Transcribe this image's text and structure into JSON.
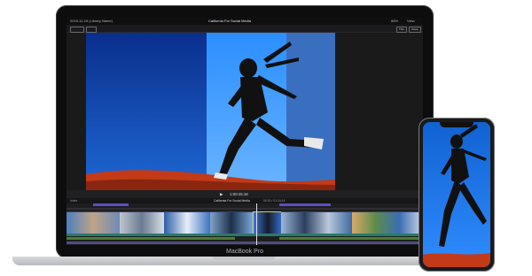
{
  "menubar": {
    "library_name": "2019-11-15 (Library Name)",
    "project_title": "California For Social Media",
    "zoom": "86%",
    "view_label": "View"
  },
  "toolbar": {
    "button_labels": [
      "Trim",
      "Done"
    ]
  },
  "transport": {
    "timecode": "1:00:45:18"
  },
  "timeline_header": {
    "label": "Index",
    "title": "California For Social Media",
    "duration": "00:30 / 01:24:14"
  },
  "device_label": "MacBook Pro",
  "colors": {
    "sky_deep": "#0a2f8c",
    "sky_light": "#2b8eff",
    "highlight": "#cfe8ff",
    "grass": "#c23a17",
    "timeline_purple": "#5a4fbf",
    "timeline_teal": "#2a7a6b",
    "timeline_green": "#4f7a34"
  }
}
